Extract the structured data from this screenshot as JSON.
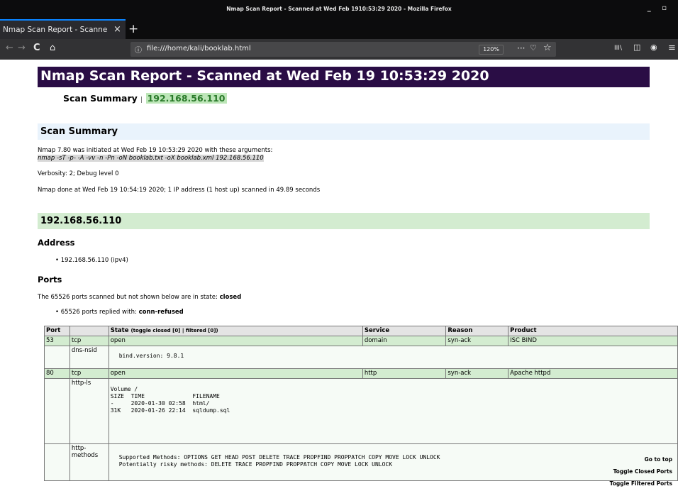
{
  "window": {
    "title": "Nmap Scan Report - Scanned at Wed Feb 1910:53:29 2020 - Mozilla Firefox",
    "controls": "_ ▫"
  },
  "tab": {
    "title": "Nmap Scan Report - Scanne",
    "close": "×",
    "new": "+"
  },
  "nav": {
    "back": "←",
    "forward": "→",
    "reload": "C",
    "home": "⌂",
    "info": "ⓘ",
    "url": "file:///home/kali/booklab.html",
    "zoom": "120%",
    "more": "···",
    "pocket": "♡",
    "star": "☆",
    "library": "III\\",
    "sidebar": "◫",
    "account": "◉",
    "menu": "≡"
  },
  "report": {
    "title": "Nmap Scan Report - Scanned at Wed Feb 19 10:53:29 2020",
    "summary_label": "Scan Summary",
    "separator": "|",
    "ip": "192.168.56.110"
  },
  "scan_summary": {
    "heading": "Scan Summary",
    "line1": "Nmap 7.80 was initiated at Wed Feb 19 10:53:29 2020 with these arguments:",
    "args": "nmap -sT -p- -A -vv -n -Pn -oN booklab.txt -oX booklab.xml 192.168.56.110",
    "verbosity": "Verbosity: 2; Debug level 0",
    "done": "Nmap done at Wed Feb 19 10:54:19 2020; 1 IP address (1 host up) scanned in 49.89 seconds"
  },
  "host": {
    "heading": "192.168.56.110",
    "address_heading": "Address",
    "address": "192.168.56.110 (ipv4)",
    "ports_heading": "Ports",
    "not_shown_prefix": "The 65526 ports scanned but not shown below are in state: ",
    "not_shown_state": "closed",
    "replied_prefix": "65526 ports replied with: ",
    "replied_reason": "conn-refused"
  },
  "ports_table": {
    "headers": {
      "port": "Port",
      "state": "State",
      "state_toggle": "(toggle closed [0] | filtered [0])",
      "service": "Service",
      "reason": "Reason",
      "product": "Product"
    },
    "rows": [
      {
        "port": "53",
        "proto": "tcp",
        "state": "open",
        "service": "domain",
        "reason": "syn-ack",
        "product": "ISC BIND"
      },
      {
        "port": "80",
        "proto": "tcp",
        "state": "open",
        "service": "http",
        "reason": "syn-ack",
        "product": "Apache httpd"
      }
    ],
    "scripts": {
      "dns_nsid": {
        "name": "dns-nsid",
        "output": "bind.version: 9.8.1"
      },
      "http_ls": {
        "name": "http-ls",
        "output": "Volume /\nSIZE  TIME              FILENAME\n-     2020-01-30 02:58  html/\n31K   2020-01-26 22:14  sqldump.sql"
      },
      "http_methods": {
        "name": "http-\nmethods",
        "output": "Supported Methods: OPTIONS GET HEAD POST DELETE TRACE PROPFIND PROPPATCH COPY MOVE LOCK UNLOCK\nPotentially risky methods: DELETE TRACE PROPFIND PROPPATCH COPY MOVE LOCK UNLOCK"
      }
    }
  },
  "float_links": {
    "go_top": "Go to top",
    "toggle_closed": "Toggle Closed Ports",
    "toggle_filtered": "Toggle Filtered Ports"
  },
  "colors": {
    "title_bg": "#2a0d45",
    "summary_bg": "#e9f3fc",
    "host_bg": "#d3ecd0",
    "open_row_bg": "#d3ecd0"
  }
}
